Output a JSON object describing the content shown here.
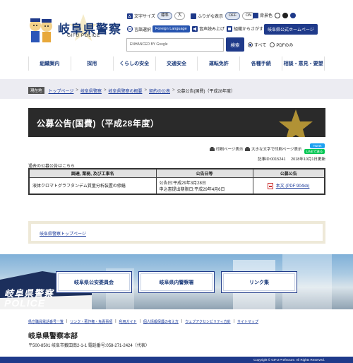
{
  "header": {
    "site_title": "岐阜県警察",
    "site_subtitle": "GIFU POLICE",
    "font_size_label": "文字サイズ",
    "font_size_standard": "標準",
    "font_size_large": "大",
    "furigana_label": "ふりがな表示",
    "furigana_off": "OFF",
    "furigana_on": "ON",
    "bg_color_label": "背景色",
    "bg_white": "白",
    "bg_black": "黒",
    "bg_blue": "青",
    "language_label": "言語選択",
    "language_button": "Foreign Language",
    "voice_label": "音声読み上げ",
    "organization_label": "組織からさがす",
    "pref_home_button": "岐阜県公式ホームページ",
    "search_placeholder": "ENHANCED BY Google",
    "search_button": "検索",
    "radio_all": "すべて",
    "radio_pdf": "PDFのみ"
  },
  "nav": {
    "items": [
      {
        "label": "組織案内"
      },
      {
        "label": "採用"
      },
      {
        "label": "くらしの安全"
      },
      {
        "label": "交通安全"
      },
      {
        "label": "運転免許"
      },
      {
        "label": "各種手続"
      },
      {
        "label": "相談・意見・要望"
      }
    ]
  },
  "breadcrumb": {
    "current_label": "現在地",
    "links": [
      "トップページ",
      "岐阜県警察",
      "岐阜県警察の概要",
      "契約の公表"
    ],
    "current": "公募公告(国費)（平成28年度）"
  },
  "page": {
    "title": "公募公告(国費)（平成28年度）",
    "print_label": "印刷ページ表示",
    "large_print_label": "大きな文字で印刷ページ表示",
    "tweet_label": "Tweet",
    "line_label": "LINEで送る",
    "record_id": "記事ID:0015241",
    "updated": "2018年10月1日更新",
    "past_notice": "過去の公募公告はこちら"
  },
  "table": {
    "headers": [
      "調達, 業務, 及び工事名",
      "公告日等",
      "公募公告"
    ],
    "rows": [
      {
        "name": "液体クロマトグラフタンデム質量分析装置の修繕",
        "date_line1": "公告日:平成29年3月28日",
        "date_line2": "申込書提出期限日:平成29年4月6日",
        "file_label": "本文 (PDF:904kb)"
      }
    ]
  },
  "top_link": "岐阜県警察トップページ",
  "footer": {
    "police_text_1": "岐阜県警察",
    "police_text_2": "POLICE",
    "buttons": [
      "岐阜県公安委員会",
      "岐阜県内警察署",
      "リンク集"
    ],
    "links": [
      "県庁職員電話番号一覧",
      "リンク・著作権・免責事項",
      "利用ガイド",
      "個人情報保護の考え方",
      "ウェブアクセシビリティ方針",
      "サイトマップ"
    ],
    "hq_name": "岐阜県警察本部",
    "hq_address": "〒500-8501 岐阜市薮田南2-1-1 電話番号:058-271-2424（代表）",
    "copyright": "Copyright © GIFU Prefecture. All Rights Reserved."
  },
  "colors": {
    "brand_navy": "#1f3a8a",
    "title_band": "#2a2a2a",
    "breadcrumb_bg": "#ececf2"
  }
}
